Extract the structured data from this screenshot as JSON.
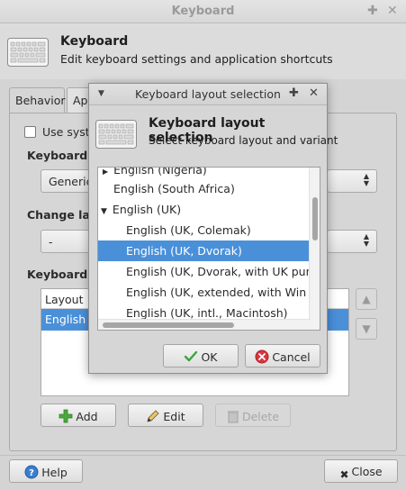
{
  "main_window": {
    "title": "Keyboard",
    "header": {
      "title": "Keyboard",
      "subtitle": "Edit keyboard settings and application shortcuts"
    },
    "tabs": [
      {
        "label": "Behavior"
      },
      {
        "label": "Ap"
      }
    ],
    "use_system_label": "Use syste",
    "keyboard_model_label": "Keyboard m",
    "keyboard_model_value": "Generic",
    "change_layout_label": "Change laye",
    "change_layout_value": "-",
    "keyboard_layouts_label": "Keyboard la",
    "layout_table": {
      "column_header": "Layout",
      "rows": [
        "English (U"
      ]
    },
    "buttons": {
      "add": "Add",
      "edit": "Edit",
      "delete": "Delete",
      "help": "Help",
      "close": "Close"
    }
  },
  "dialog": {
    "title": "Keyboard layout selection",
    "header_title": "Keyboard layout selection",
    "header_subtitle": "Select keyboard layout and variant",
    "list_items": [
      {
        "label": "English (Nigeria)",
        "level": 0,
        "expanded": false
      },
      {
        "label": "English (South Africa)",
        "level": 0
      },
      {
        "label": "English (UK)",
        "level": 0,
        "expanded": true
      },
      {
        "label": "English (UK, Colemak)",
        "level": 1
      },
      {
        "label": "English (UK, Dvorak)",
        "level": 1,
        "selected": true
      },
      {
        "label": "English (UK, Dvorak, with UK punctu",
        "level": 1
      },
      {
        "label": "English (UK, extended, with Win keys",
        "level": 1
      },
      {
        "label": "English (UK, intl., Macintosh)",
        "level": 1
      }
    ],
    "buttons": {
      "ok": "OK",
      "cancel": "Cancel"
    }
  },
  "colors": {
    "selection": "#4a90d9",
    "ok_check": "#3aa53a",
    "cancel_x": "#d9363e",
    "add_plus": "#4aab3c"
  },
  "icons": [
    "keyboard-icon",
    "plus-icon",
    "close-icon",
    "chevron-down-icon",
    "checkmark-icon",
    "cancel-icon",
    "pencil-icon",
    "trash-icon",
    "help-icon",
    "arrow-up-icon",
    "arrow-down-icon"
  ]
}
